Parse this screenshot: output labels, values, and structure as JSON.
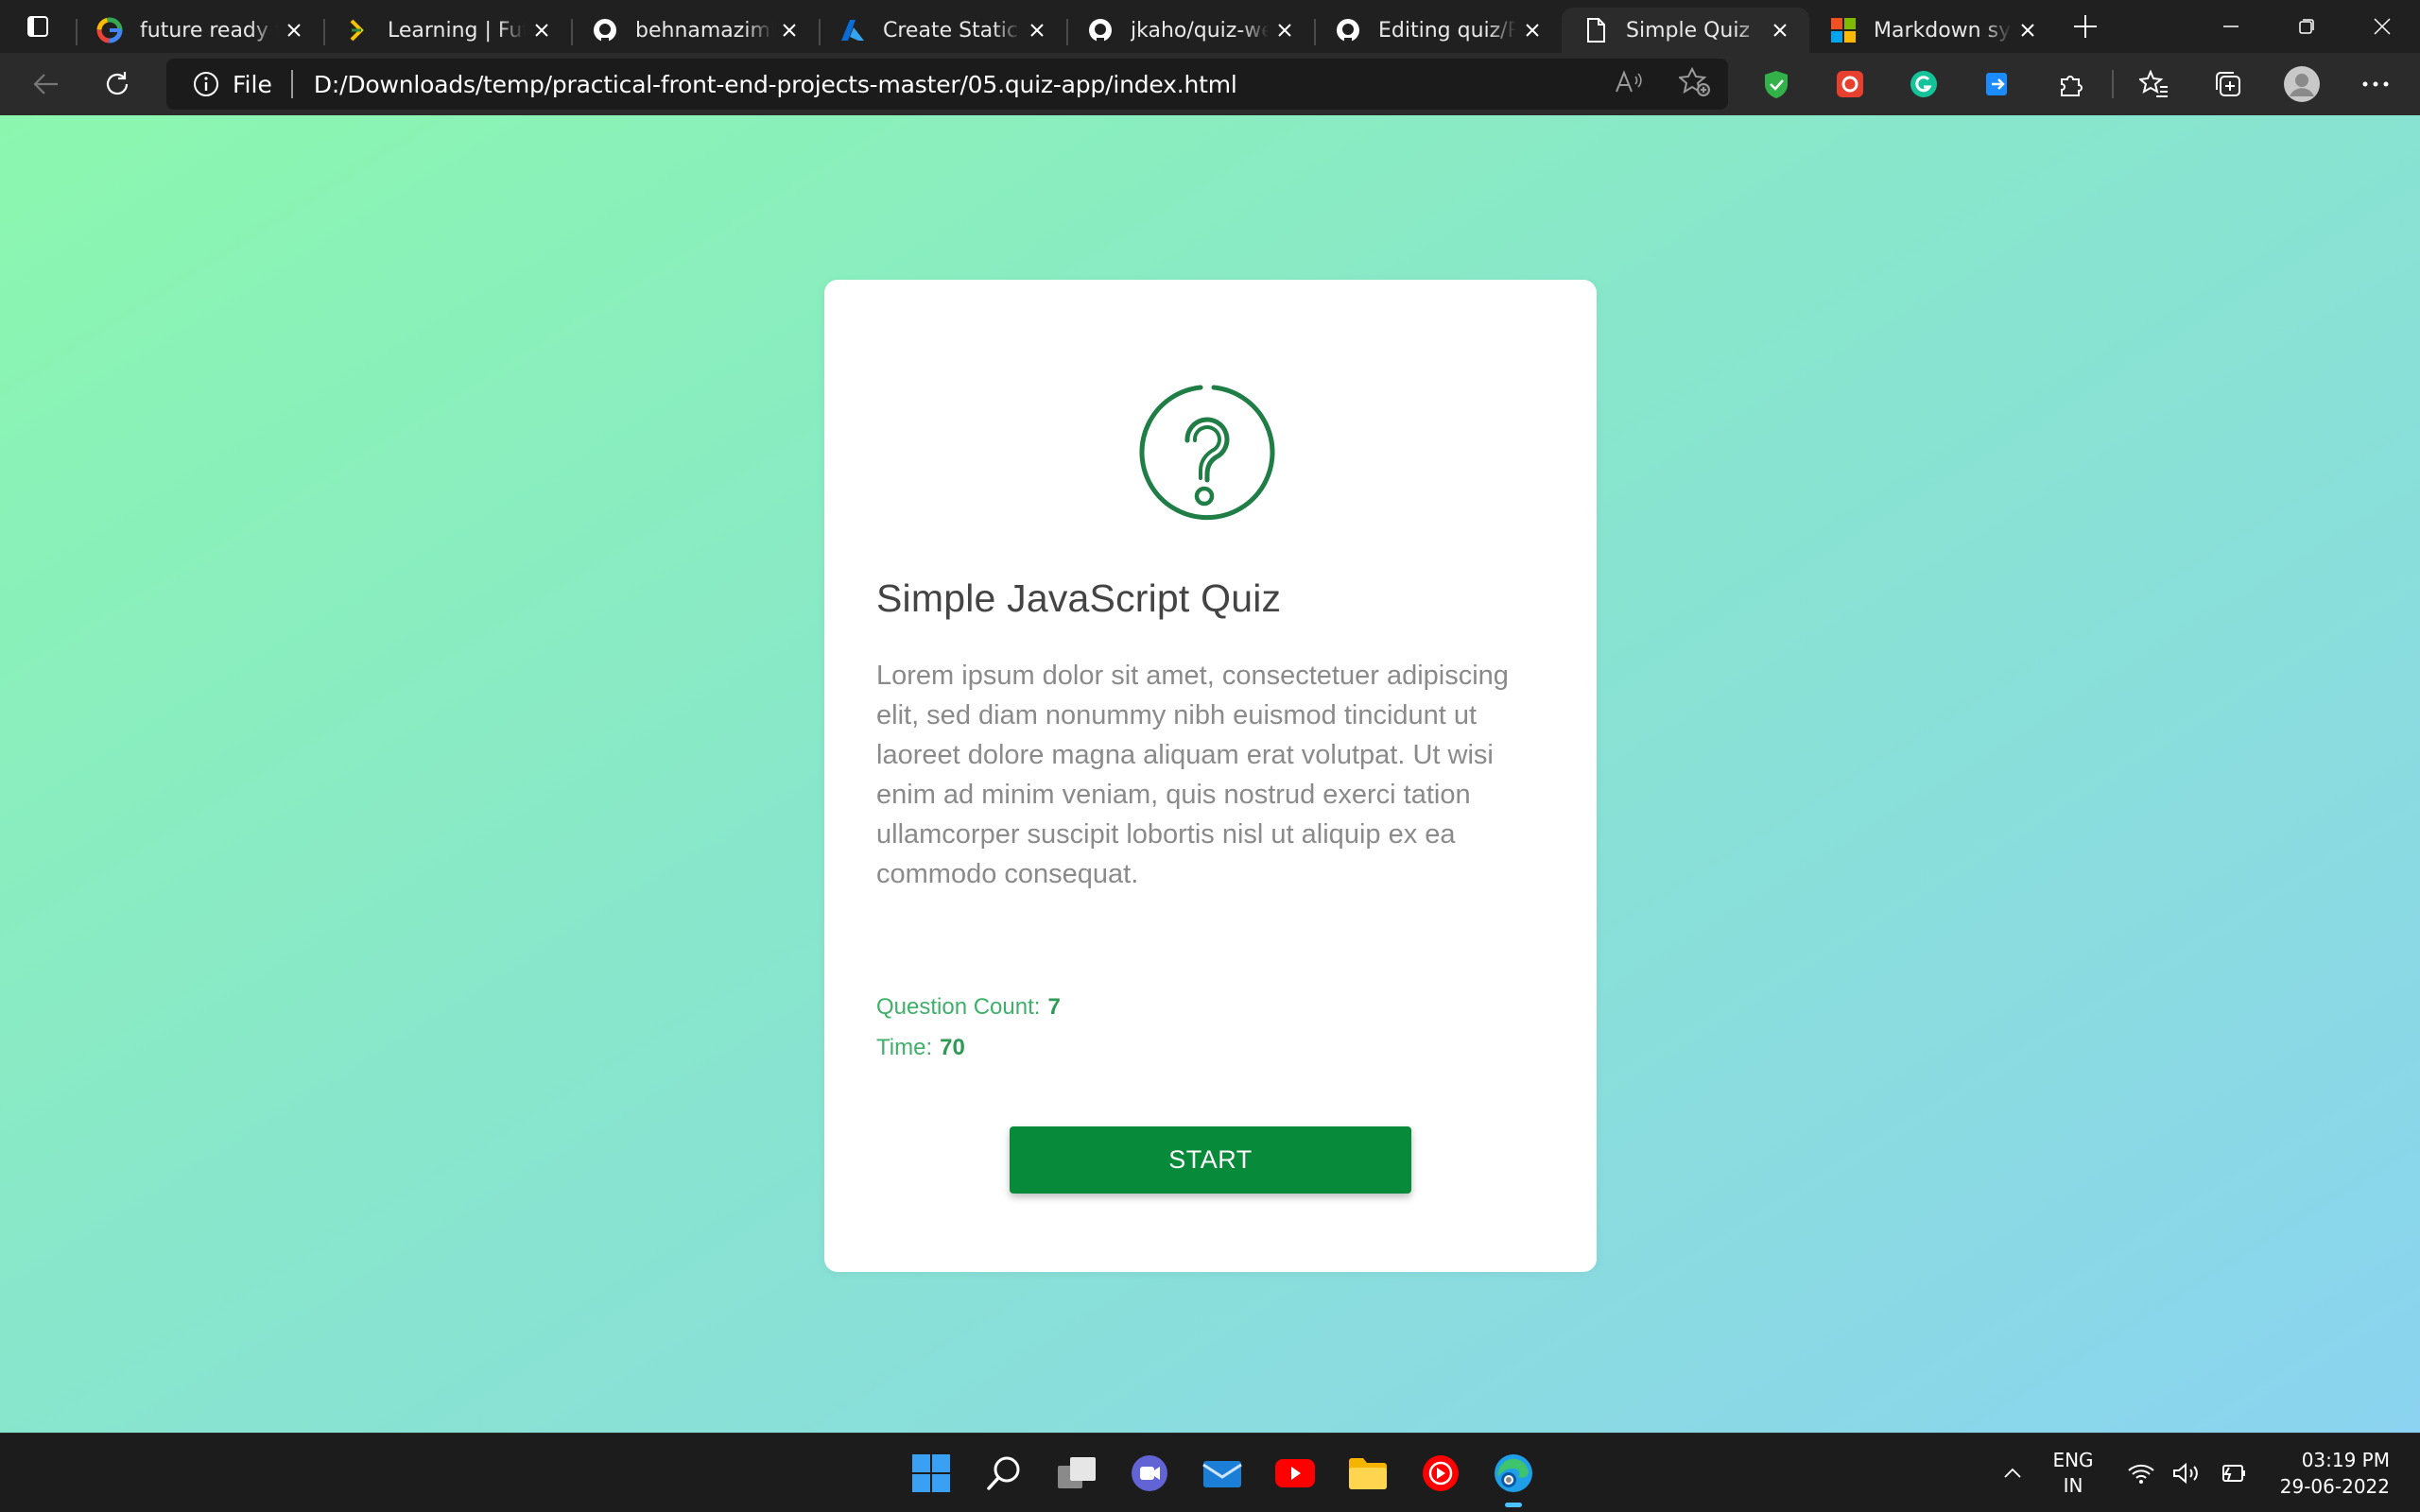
{
  "browser": {
    "tabs": [
      {
        "title": "future ready talent",
        "favicon": "google-icon",
        "active": false
      },
      {
        "title": "Learning | Future Ready Talent",
        "favicon": "learning-chevron-icon",
        "active": false
      },
      {
        "title": "behnamazimi/practical",
        "favicon": "github-icon",
        "active": false
      },
      {
        "title": "Create Static Web App",
        "favicon": "azure-icon",
        "active": false
      },
      {
        "title": "jkaho/quiz-web-app",
        "favicon": "github-icon",
        "active": false
      },
      {
        "title": "Editing quiz/README",
        "favicon": "github-icon",
        "active": false
      },
      {
        "title": "Simple Quiz",
        "favicon": "page-icon",
        "active": true
      },
      {
        "title": "Markdown syntax",
        "favicon": "microsoft-icon",
        "active": false
      }
    ],
    "address": {
      "scheme_label": "File",
      "url": "D:/Downloads/temp/practical-front-end-projects-master/05.quiz-app/index.html"
    }
  },
  "quiz": {
    "title": "Simple JavaScript Quiz",
    "description": "Lorem ipsum dolor sit amet, consectetuer adipiscing elit, sed diam nonummy nibh euismod tincidunt ut laoreet dolore magna aliquam erat volutpat. Ut wisi enim ad minim veniam, quis nostrud exerci tation ullamcorper suscipit lobortis nisl ut aliquip ex ea commodo consequat.",
    "question_count_label": "Question Count:",
    "question_count": "7",
    "time_label": "Time:",
    "time": "70",
    "start_label": "START"
  },
  "taskbar": {
    "lang_line1": "ENG",
    "lang_line2": "IN",
    "time": "03:19 PM",
    "date": "29-06-2022"
  },
  "colors": {
    "accent_green": "#078a3a",
    "gradient_start": "#8bf7ae",
    "gradient_end": "#8bd3f0"
  }
}
